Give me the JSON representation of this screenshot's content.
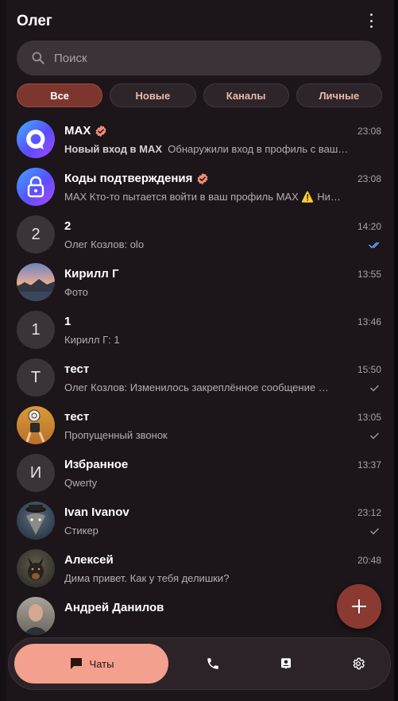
{
  "header": {
    "title": "Олег",
    "menu_icon": "more-vertical-icon"
  },
  "search": {
    "placeholder": "Поиск",
    "value": ""
  },
  "filters": [
    {
      "label": "Все",
      "active": true
    },
    {
      "label": "Новые",
      "active": false
    },
    {
      "label": "Каналы",
      "active": false
    },
    {
      "label": "Личные",
      "active": false
    }
  ],
  "chats": [
    {
      "name": "MAX",
      "verified": true,
      "time": "23:08",
      "preview_bold": "Новый вход в MAX",
      "preview": "Обнаружили вход в профиль с ваш…",
      "avatar_type": "max-logo-icon",
      "status": ""
    },
    {
      "name": "Коды подтверждения",
      "verified": true,
      "time": "23:08",
      "preview_bold": "",
      "preview": "MAX Кто-то пытается войти в ваш профиль MAX ⚠️ Ни…",
      "avatar_type": "lock-icon",
      "status": ""
    },
    {
      "name": "2",
      "verified": false,
      "time": "14:20",
      "preview_bold": "",
      "preview": "Олег Козлов: olo",
      "avatar_letter": "2",
      "status": "read"
    },
    {
      "name": "Кирилл Г",
      "verified": false,
      "time": "13:55",
      "preview_bold": "",
      "preview": "Фото",
      "avatar_type": "landscape-photo",
      "status": ""
    },
    {
      "name": "1",
      "verified": false,
      "time": "13:46",
      "preview_bold": "",
      "preview": "Кирилл Г: 1",
      "avatar_letter": "1",
      "status": ""
    },
    {
      "name": "тест",
      "verified": false,
      "time": "15:50",
      "preview_bold": "",
      "preview": "Олег Козлов: Изменилось закреплённое сообщение …",
      "avatar_letter": "Т",
      "status": "sent"
    },
    {
      "name": "тест",
      "verified": false,
      "time": "13:05",
      "preview_bold": "",
      "preview": "Пропущенный звонок",
      "avatar_type": "runner-photo",
      "status": "sent"
    },
    {
      "name": "Избранное",
      "verified": false,
      "time": "13:37",
      "preview_bold": "",
      "preview": "Qwerty",
      "avatar_letter": "И",
      "status": ""
    },
    {
      "name": "Ivan Ivanov",
      "verified": false,
      "time": "23:12",
      "preview_bold": "",
      "preview": "Стикер",
      "avatar_type": "wolf-photo",
      "status": "sent"
    },
    {
      "name": "Алексей",
      "verified": false,
      "time": "20:48",
      "preview_bold": "",
      "preview": "Дима привет. Как у тебя делишки?",
      "avatar_type": "dog-photo",
      "status": ""
    },
    {
      "name": "Андрей Данилов",
      "verified": false,
      "time": "",
      "preview_bold": "",
      "preview": "",
      "avatar_type": "man-photo",
      "status": ""
    }
  ],
  "fab": {
    "icon": "plus-icon"
  },
  "navbar": {
    "chats_label": "Чаты",
    "chats_icon": "chat-bubble-icon",
    "calls_icon": "phone-icon",
    "contacts_icon": "contacts-icon",
    "settings_icon": "gear-icon"
  },
  "colors": {
    "background": "#1c1519",
    "accent": "#f4a08e",
    "active_chip": "#7d362e",
    "fab": "#8a3a31"
  }
}
